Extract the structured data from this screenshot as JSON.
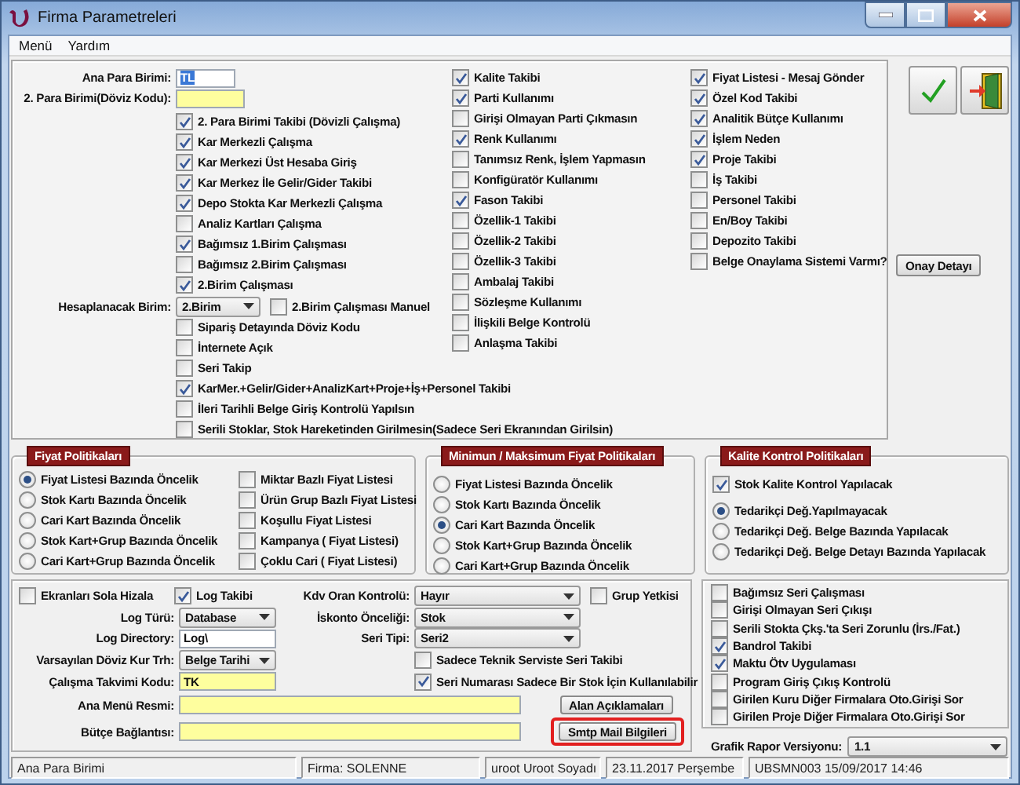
{
  "window": {
    "title": "Firma Parametreleri"
  },
  "menu": [
    {
      "label": "Menü"
    },
    {
      "label": "Yardım"
    }
  ],
  "general": {
    "fields": [
      {
        "label": "Ana Para Birimi:",
        "value": "TL",
        "text_highlighted": true,
        "required": false
      },
      {
        "label": "2. Para Birimi(Döviz Kodu):",
        "text_highlighted": false,
        "required": true
      }
    ],
    "left_options": [
      {
        "kind": "check",
        "label": "2. Para Birimi Takibi (Dövizli Çalışma)",
        "checked": true
      },
      {
        "kind": "check",
        "label": "Kar Merkezli Çalışma",
        "checked": true
      },
      {
        "kind": "check",
        "label": "Kar Merkezi Üst Hesaba Giriş",
        "checked": true
      },
      {
        "kind": "check",
        "label": "Kar Merkez İle Gelir/Gider Takibi",
        "checked": true
      },
      {
        "kind": "check",
        "label": "Depo Stokta Kar Merkezli Çalışma",
        "checked": true
      },
      {
        "kind": "check",
        "label": "Analiz Kartları Çalışma",
        "checked": false
      },
      {
        "kind": "check",
        "label": "Bağımsız 1.Birim Çalışması",
        "checked": true
      },
      {
        "kind": "check",
        "label": "Bağımsız 2.Birim Çalışması",
        "checked": false
      },
      {
        "kind": "check",
        "label": "2.Birim Çalışması",
        "checked": true
      },
      {
        "kind": "select",
        "label": "Hesaplanacak Birim:",
        "value": "2.Birim",
        "option": {
          "label": "2.Birim Çalışması Manuel",
          "checked": false
        }
      },
      {
        "kind": "check",
        "label": "Sipariş Detayında Döviz Kodu",
        "checked": false
      },
      {
        "kind": "check",
        "label": "İnternete Açık",
        "checked": false
      },
      {
        "kind": "check",
        "label": "Seri Takip",
        "checked": false
      },
      {
        "kind": "check",
        "label": "KarMer.+Gelir/Gider+AnalizKart+Proje+İş+Personel Takibi",
        "checked": true
      },
      {
        "kind": "check",
        "label": "İleri Tarihli Belge Giriş Kontrolü Yapılsın",
        "checked": false
      },
      {
        "kind": "check",
        "label": "Serili Stoklar, Stok Hareketinden Girilmesin(Sadece Seri Ekranından Girilsin)",
        "checked": false
      }
    ],
    "middle_options": [
      {
        "label": "Kalite Takibi",
        "checked": true
      },
      {
        "label": "Parti Kullanımı",
        "checked": true
      },
      {
        "label": "Girişi Olmayan Parti Çıkmasın",
        "checked": false
      },
      {
        "label": "Renk Kullanımı",
        "checked": true
      },
      {
        "label": "Tanımsız Renk, İşlem Yapmasın",
        "checked": false
      },
      {
        "label": "Konfigüratör Kullanımı",
        "checked": false
      },
      {
        "label": "Fason Takibi",
        "checked": true
      },
      {
        "label": "Özellik-1 Takibi",
        "checked": false
      },
      {
        "label": "Özellik-2 Takibi",
        "checked": false
      },
      {
        "label": "Özellik-3 Takibi",
        "checked": false
      },
      {
        "label": "Ambalaj Takibi",
        "checked": false
      },
      {
        "label": "Sözleşme Kullanımı",
        "checked": false
      },
      {
        "label": "İlişkili Belge Kontrolü",
        "checked": false
      },
      {
        "label": "Anlaşma Takibi",
        "checked": false
      }
    ],
    "right_options": [
      {
        "label": "Fiyat Listesi - Mesaj Gönder",
        "checked": true
      },
      {
        "label": "Özel Kod Takibi",
        "checked": true
      },
      {
        "label": "Analitik Bütçe Kullanımı",
        "checked": true
      },
      {
        "label": "İşlem Neden",
        "checked": true
      },
      {
        "label": "Proje Takibi",
        "checked": true
      },
      {
        "label": "İş Takibi",
        "checked": false
      },
      {
        "label": "Personel Takibi",
        "checked": false
      },
      {
        "label": "En/Boy Takibi",
        "checked": false
      },
      {
        "label": "Depozito Takibi",
        "checked": false
      },
      {
        "label": "Belge Onaylama Sistemi Varmı?",
        "checked": false
      }
    ]
  },
  "onay_button": {
    "label": "Onay Detayı"
  },
  "price_policies": {
    "title": "Fiyat Politikaları",
    "options": [
      {
        "label": "Fiyat Listesi Bazında Öncelik",
        "selected": true
      },
      {
        "label": "Stok Kartı Bazında Öncelik",
        "selected": false
      },
      {
        "label": "Cari Kart Bazında Öncelik",
        "selected": false
      },
      {
        "label": "Stok Kart+Grup Bazında Öncelik",
        "selected": false
      },
      {
        "label": "Cari Kart+Grup Bazında Öncelik",
        "selected": false
      }
    ],
    "checks": [
      {
        "label": "Miktar Bazlı Fiyat Listesi",
        "checked": false
      },
      {
        "label": "Ürün Grup Bazlı Fiyat Listesi",
        "checked": false
      },
      {
        "label": "Koşullu Fiyat Listesi",
        "checked": false
      },
      {
        "label": "Kampanya ( Fiyat Listesi)",
        "checked": false
      },
      {
        "label": "Çoklu Cari ( Fiyat Listesi)",
        "checked": false
      }
    ]
  },
  "minmax_policies": {
    "title": "Minimun / Maksimum Fiyat Politikaları",
    "options": [
      {
        "label": "Fiyat Listesi Bazında Öncelik",
        "selected": false
      },
      {
        "label": "Stok Kartı Bazında Öncelik",
        "selected": false
      },
      {
        "label": "Cari Kart Bazında Öncelik",
        "selected": true
      },
      {
        "label": "Stok Kart+Grup Bazında Öncelik",
        "selected": false
      },
      {
        "label": "Cari Kart+Grup Bazında Öncelik",
        "selected": false
      }
    ]
  },
  "quality_policies": {
    "title": "Kalite Kontrol Politikaları",
    "check": {
      "label": "Stok Kalite Kontrol Yapılacak",
      "checked": true
    },
    "options": [
      {
        "label": "Tedarikçi Değ.Yapılmayacak",
        "selected": true
      },
      {
        "label": "Tedarikçi Değ. Belge Bazında Yapılacak",
        "selected": false
      },
      {
        "label": "Tedarikçi Değ. Belge Detayı Bazında Yapılacak",
        "selected": false
      }
    ]
  },
  "settings": {
    "rows": [
      {
        "left": [
          {
            "kind": "check",
            "label": "Ekranları Sola Hizala",
            "checked": false
          },
          {
            "kind": "check",
            "label": "Log Takibi",
            "checked": true
          }
        ],
        "right": [
          {
            "kind": "select",
            "label": "Kdv Oran Kontrolü:",
            "value": "Hayır"
          },
          {
            "kind": "check",
            "label": "Grup Yetkisi",
            "checked": false
          }
        ]
      },
      {
        "left": [
          {
            "kind": "select",
            "label": "Log Türü:",
            "value": "Database"
          }
        ],
        "right": [
          {
            "kind": "select",
            "label": "İskonto Önceliği:",
            "value": "Stok"
          }
        ]
      },
      {
        "left": [
          {
            "kind": "input",
            "label": "Log Directory:",
            "value": "Log\\",
            "required": false
          }
        ],
        "right": [
          {
            "kind": "select",
            "label": "Seri Tipi:",
            "value": "Seri2"
          }
        ]
      },
      {
        "left": [
          {
            "kind": "select",
            "label": "Varsayılan Döviz Kur Trh:",
            "value": "Belge Tarihi"
          }
        ],
        "right": [
          {
            "kind": "check",
            "label": "Sadece Teknik Serviste Seri Takibi",
            "checked": false
          }
        ]
      },
      {
        "left": [
          {
            "kind": "input",
            "label": "Çalışma Takvimi Kodu:",
            "value": "TK",
            "required": true
          }
        ],
        "right": [
          {
            "kind": "check",
            "label": "Seri Numarası Sadece Bir Stok İçin Kullanılabilir",
            "checked": true
          }
        ]
      },
      {
        "left": [
          {
            "kind": "wide_input",
            "label": "Ana Menü Resmi:",
            "required": true
          }
        ],
        "right": [
          {
            "kind": "button",
            "label": "Alan Açıklamaları",
            "highlighted": false
          }
        ]
      },
      {
        "left": [
          {
            "kind": "wide_input",
            "label": "Bütçe Bağlantısı:",
            "required": true
          }
        ],
        "right": [
          {
            "kind": "button",
            "label": "Smtp Mail Bilgileri",
            "highlighted": true
          }
        ]
      }
    ]
  },
  "serial_options": [
    {
      "label": "Bağımsız Seri Çalışması",
      "checked": false
    },
    {
      "label": "Girişi Olmayan Seri Çıkışı",
      "checked": false
    },
    {
      "label": "Serili Stokta Çkş.'ta Seri Zorunlu (İrs./Fat.)",
      "checked": false
    },
    {
      "label": "Bandrol Takibi",
      "checked": true
    },
    {
      "label": "Maktu Ötv Uygulaması",
      "checked": true
    },
    {
      "label": "Program Giriş Çıkış Kontrolü",
      "checked": false
    },
    {
      "label": "Girilen Kuru Diğer Firmalara Oto.Girişi Sor",
      "checked": false
    },
    {
      "label": "Girilen Proje Diğer Firmalara Oto.Girişi Sor",
      "checked": false
    }
  ],
  "report_version": {
    "label": "Grafik Rapor Versiyonu:",
    "value": "1.1"
  },
  "status_bar": [
    "Ana Para Birimi",
    "Firma: SOLENNE",
    "uroot Uroot Soyadı",
    "23.11.2017 Perşembe",
    "UBSMN003 15/09/2017 14:46"
  ]
}
